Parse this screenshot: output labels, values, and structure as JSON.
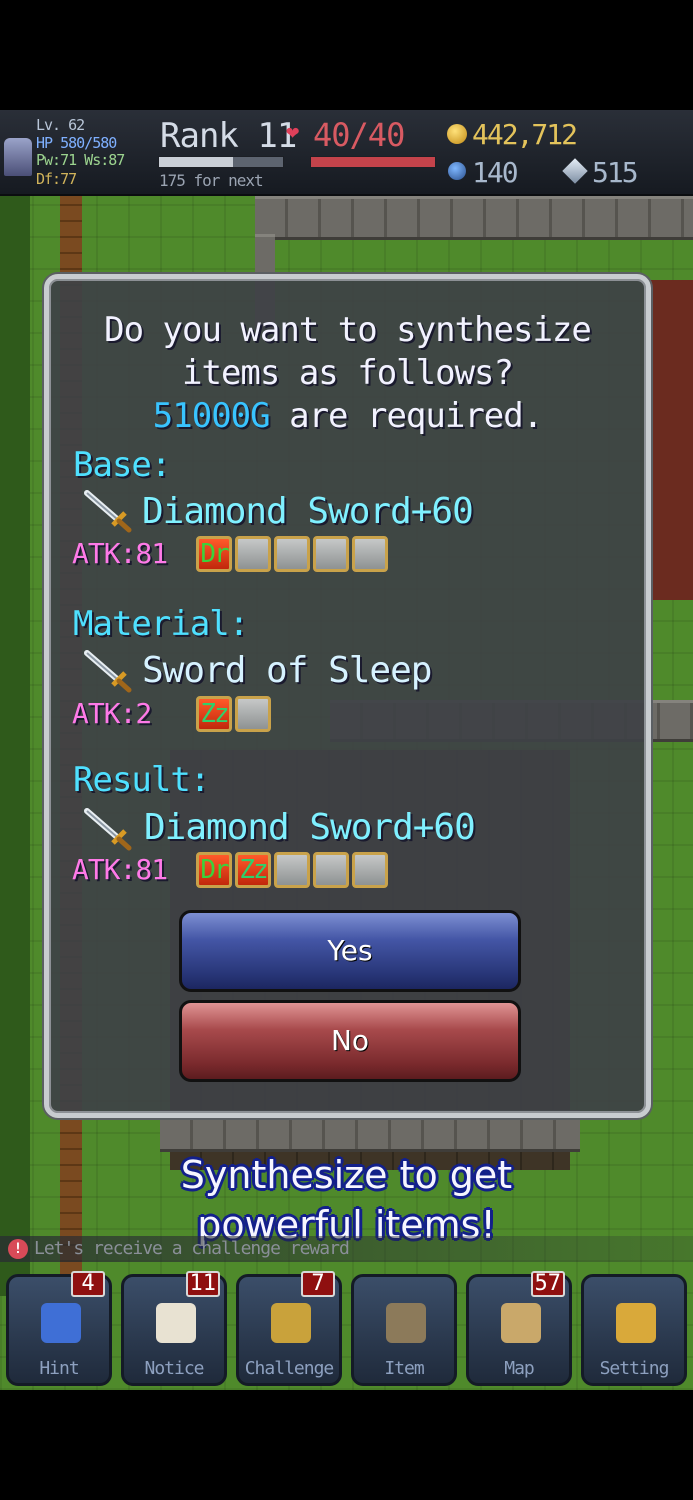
{
  "status": {
    "level": "Lv. 62",
    "hp": "HP 580/580",
    "pw_ws": "Pw:71 Ws:87",
    "df": "Df:77",
    "rank": "Rank 11",
    "rank_progress": 0.6,
    "next": "175 for next",
    "stamina": "40/40",
    "stamina_progress": 1.0,
    "gold": "442,712",
    "orbs": "140",
    "gems": "515"
  },
  "dialog": {
    "question_line1": "Do you want to synthesize",
    "question_line2": "items as follows?",
    "cost": "51000G",
    "cost_suffix": " are required.",
    "base": {
      "heading": "Base:",
      "name": "Diamond Sword+60",
      "atk": "ATK:81",
      "slots": [
        "Dr",
        "",
        "",
        "",
        ""
      ]
    },
    "material": {
      "heading": "Material:",
      "name": "Sword of Sleep",
      "atk": "ATK:2",
      "slots": [
        "Zz",
        ""
      ]
    },
    "result": {
      "heading": "Result:",
      "name": "Diamond Sword+60",
      "atk": "ATK:81",
      "slots": [
        "Dr",
        "Zz",
        "",
        "",
        ""
      ]
    },
    "yes_label": "Yes",
    "no_label": "No"
  },
  "caption_line1": "Synthesize to get",
  "caption_line2": "powerful items!",
  "notification": "Let's receive a challenge reward",
  "nav": [
    {
      "label": "Hint",
      "badge": "4",
      "icon": "hint-icon"
    },
    {
      "label": "Notice",
      "badge": "11",
      "icon": "letter-icon"
    },
    {
      "label": "Challenge",
      "badge": "7",
      "icon": "trophy-icon"
    },
    {
      "label": "Item",
      "badge": "",
      "icon": "bag-icon"
    },
    {
      "label": "Map",
      "badge": "57",
      "icon": "map-icon"
    },
    {
      "label": "Setting",
      "badge": "",
      "icon": "book-icon"
    }
  ],
  "colors": {
    "cost": "#39c4ff",
    "section_heading": "#4fe0ff",
    "atk": "#ff7ae8",
    "yes_button": "#4456a6",
    "no_button": "#a84a4c",
    "caption_outline": "#13208a"
  }
}
